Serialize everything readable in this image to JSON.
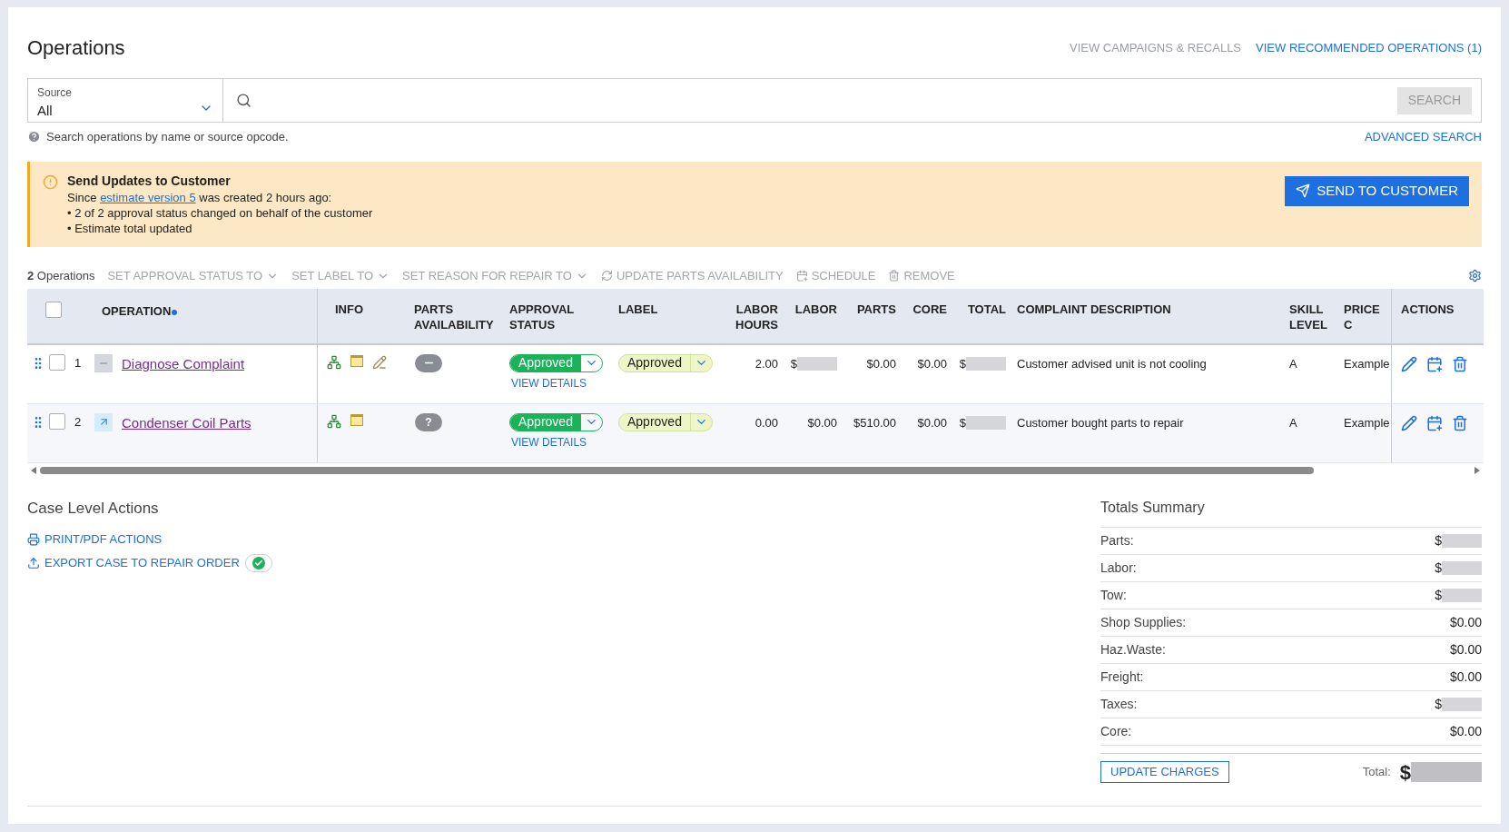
{
  "page_title": "Operations",
  "top_links": [
    {
      "text": "VIEW CAMPAIGNS & RECALLS",
      "disabled": true
    },
    {
      "text": "VIEW RECOMMENDED OPERATIONS (1)",
      "disabled": false
    }
  ],
  "search": {
    "source_label": "Source",
    "source_value": "All",
    "button": "SEARCH",
    "button_disabled": true,
    "help": "Search operations by name or source opcode.",
    "advanced": "ADVANCED SEARCH"
  },
  "banner": {
    "title": "Send Updates to Customer",
    "before": "Since ",
    "link": "estimate version 5",
    "after": " was created 2 hours ago:",
    "bullets": [
      "• 2 of 2 approval status changed on behalf of the customer",
      "• Estimate total updated"
    ],
    "button": "SEND TO CUSTOMER"
  },
  "toolbar": {
    "count": "**2** Operations",
    "actions": [
      {
        "text": "SET APPROVAL STATUS TO",
        "kind": "dropdown",
        "disabled": true
      },
      {
        "text": "SET LABEL TO",
        "kind": "dropdown",
        "disabled": true
      },
      {
        "text": "SET REASON FOR REPAIR TO",
        "kind": "dropdown",
        "disabled": true
      },
      {
        "text": "UPDATE PARTS AVAILABILITY",
        "kind": "command",
        "disabled": true
      },
      {
        "text": "SCHEDULE",
        "kind": "command",
        "disabled": true
      },
      {
        "text": "REMOVE",
        "kind": "command",
        "disabled": true
      }
    ]
  },
  "table": {
    "all_checked": false,
    "columns": [
      {
        "text": "OPERATION",
        "sorted": true
      },
      {
        "text": "INFO",
        "sorted": false
      },
      {
        "text": "PARTS AVAILABILITY",
        "sorted": false
      },
      {
        "text": "APPROVAL STATUS",
        "sorted": false
      },
      {
        "text": "LABEL",
        "sorted": false
      },
      {
        "text": "LABOR HOURS",
        "sorted": false
      },
      {
        "text": "LABOR",
        "sorted": false
      },
      {
        "text": "PARTS",
        "sorted": false
      },
      {
        "text": "CORE",
        "sorted": false
      },
      {
        "text": "TOTAL",
        "sorted": false
      },
      {
        "text": "COMPLAINT DESCRIPTION",
        "sorted": false
      },
      {
        "text": "SKILL LEVEL",
        "sorted": false
      },
      {
        "text": "PRICE C",
        "sorted": false
      },
      {
        "text": "ACTIONS",
        "sorted": false
      }
    ],
    "rows": [
      {
        "checked": false,
        "number": "1",
        "kind": "manual",
        "name": "Diagnose Complaint",
        "edited": true,
        "availability": {
          "kind": "none"
        },
        "approval": "Approved",
        "details": "VIEW DETAILS",
        "label": "Approved",
        "labor_hours": "2.00",
        "labor": {
          "text": "$",
          "redacted": true
        },
        "parts": {
          "text": "$0.00",
          "redacted": false
        },
        "core": {
          "text": "$0.00",
          "redacted": false
        },
        "total": {
          "text": "$",
          "redacted": true
        },
        "complaint": "Customer advised unit is not cooling",
        "skill": "A",
        "price": "Example"
      },
      {
        "checked": false,
        "number": "2",
        "kind": "linked",
        "name": "Condenser Coil Parts",
        "edited": false,
        "availability": {
          "kind": "unknown",
          "text": "?"
        },
        "approval": "Approved",
        "details": "VIEW DETAILS",
        "label": "Approved",
        "labor_hours": "0.00",
        "labor": {
          "text": "$0.00",
          "redacted": false
        },
        "parts": {
          "text": "$510.00",
          "redacted": false
        },
        "core": {
          "text": "$0.00",
          "redacted": false
        },
        "total": {
          "text": "$",
          "redacted": true
        },
        "complaint": "Customer bought parts to repair",
        "skill": "A",
        "price": "Example"
      }
    ]
  },
  "case_actions": {
    "title": "Case Level Actions",
    "links": [
      {
        "text": "PRINT/PDF ACTIONS",
        "done": false
      },
      {
        "text": "EXPORT CASE TO REPAIR ORDER",
        "done": true
      }
    ]
  },
  "totals": {
    "title": "Totals Summary",
    "rows": [
      {
        "label": "Parts:",
        "value": {
          "text": "$",
          "redacted": true
        }
      },
      {
        "label": "Labor:",
        "value": {
          "text": "$",
          "redacted": true
        }
      },
      {
        "label": "Tow:",
        "value": {
          "text": "$",
          "redacted": true
        }
      },
      {
        "label": "Shop Supplies:",
        "value": {
          "text": "$0.00",
          "redacted": false
        }
      },
      {
        "label": "Haz.Waste:",
        "value": {
          "text": "$0.00",
          "redacted": false
        }
      },
      {
        "label": "Freight:",
        "value": {
          "text": "$0.00",
          "redacted": false
        }
      },
      {
        "label": "Taxes:",
        "value": {
          "text": "$",
          "redacted": true
        }
      },
      {
        "label": "Core:",
        "value": {
          "text": "$0.00",
          "redacted": false
        }
      }
    ],
    "button": "UPDATE CHARGES",
    "total_label": "Total:",
    "total_value": {
      "text": "$",
      "redacted": true
    }
  }
}
